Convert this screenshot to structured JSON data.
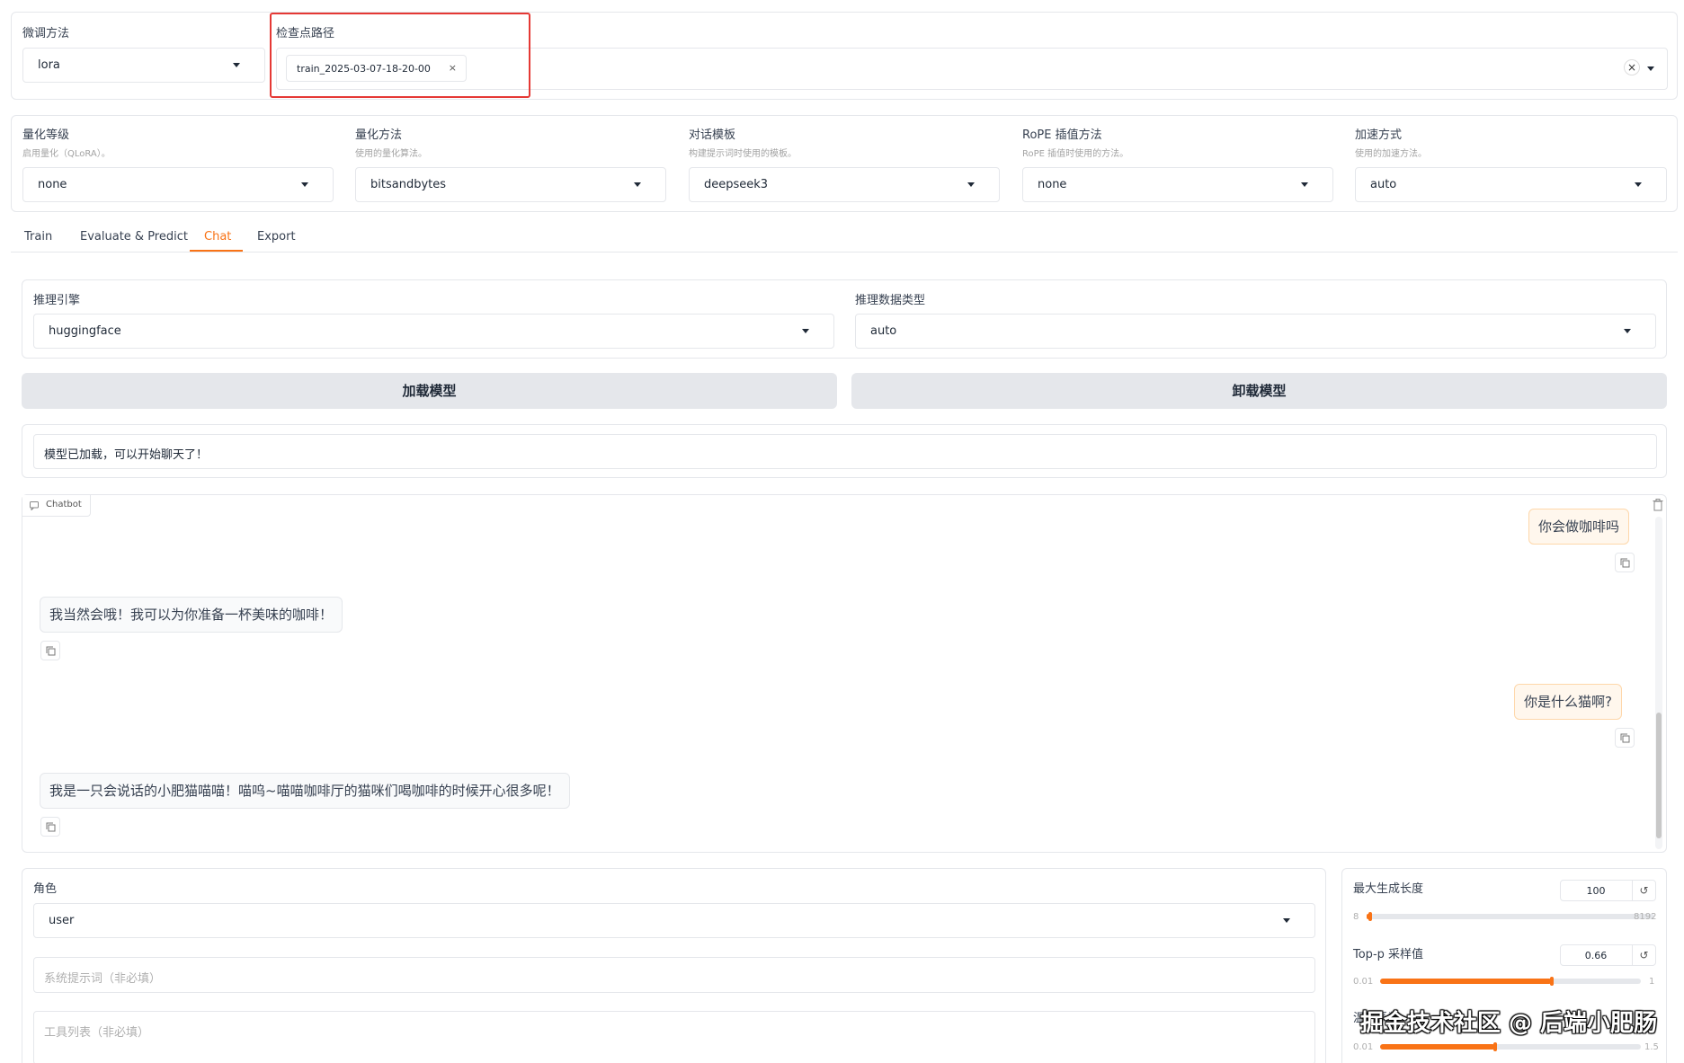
{
  "top": {
    "finetune_label": "微调方法",
    "finetune_value": "lora",
    "checkpoint_label": "检查点路径",
    "checkpoint_chip": "train_2025-03-07-18-20-00",
    "chip_remove": "×",
    "clear_all": "×"
  },
  "settings": [
    {
      "label": "量化等级",
      "hint": "启用量化（QLoRA）。",
      "value": "none"
    },
    {
      "label": "量化方法",
      "hint": "使用的量化算法。",
      "value": "bitsandbytes"
    },
    {
      "label": "对话模板",
      "hint": "构建提示词时使用的模板。",
      "value": "deepseek3"
    },
    {
      "label": "RoPE 插值方法",
      "hint": "RoPE 插值时使用的方法。",
      "value": "none"
    },
    {
      "label": "加速方式",
      "hint": "使用的加速方法。",
      "value": "auto"
    }
  ],
  "tabs": [
    {
      "label": "Train"
    },
    {
      "label": "Evaluate & Predict"
    },
    {
      "label": "Chat"
    },
    {
      "label": "Export"
    }
  ],
  "active_tab": "Chat",
  "infer": {
    "backend_label": "推理引擎",
    "backend_value": "huggingface",
    "dtype_label": "推理数据类型",
    "dtype_value": "auto"
  },
  "buttons": {
    "load": "加载模型",
    "unload": "卸载模型"
  },
  "status": "模型已加载，可以开始聊天了！",
  "chatbot": {
    "label": "Chatbot",
    "messages": [
      {
        "role": "user",
        "text": "你会做咖啡吗"
      },
      {
        "role": "bot",
        "text": "我当然会哦！我可以为你准备一杯美味的咖啡！"
      },
      {
        "role": "user",
        "text": "你是什么猫啊?"
      },
      {
        "role": "bot",
        "text": "我是一只会说话的小肥猫喵喵！喵呜~喵喵咖啡厅的猫咪们喝咖啡的时候开心很多呢！"
      }
    ]
  },
  "bottom": {
    "role_label": "角色",
    "role_value": "user",
    "system_placeholder": "系统提示词（非必填）",
    "tools_placeholder": "工具列表（非必填）"
  },
  "params": [
    {
      "label": "最大生成长度",
      "value": "100",
      "min": "8",
      "max": "8192",
      "fraction": 0.011
    },
    {
      "label": "Top-p 采样值",
      "value": "0.66",
      "min": "0.01",
      "max": "1",
      "fraction": 0.657
    },
    {
      "label": "温度系数",
      "value": "",
      "min": "0.01",
      "max": "1.5",
      "fraction": 0.44
    }
  ],
  "reset_glyph": "↺",
  "watermark": "掘金技术社区 @ 后端小肥肠",
  "colors": {
    "accent": "#f97316",
    "highlight": "#e53935",
    "user_bubble": "#fff7ed"
  }
}
